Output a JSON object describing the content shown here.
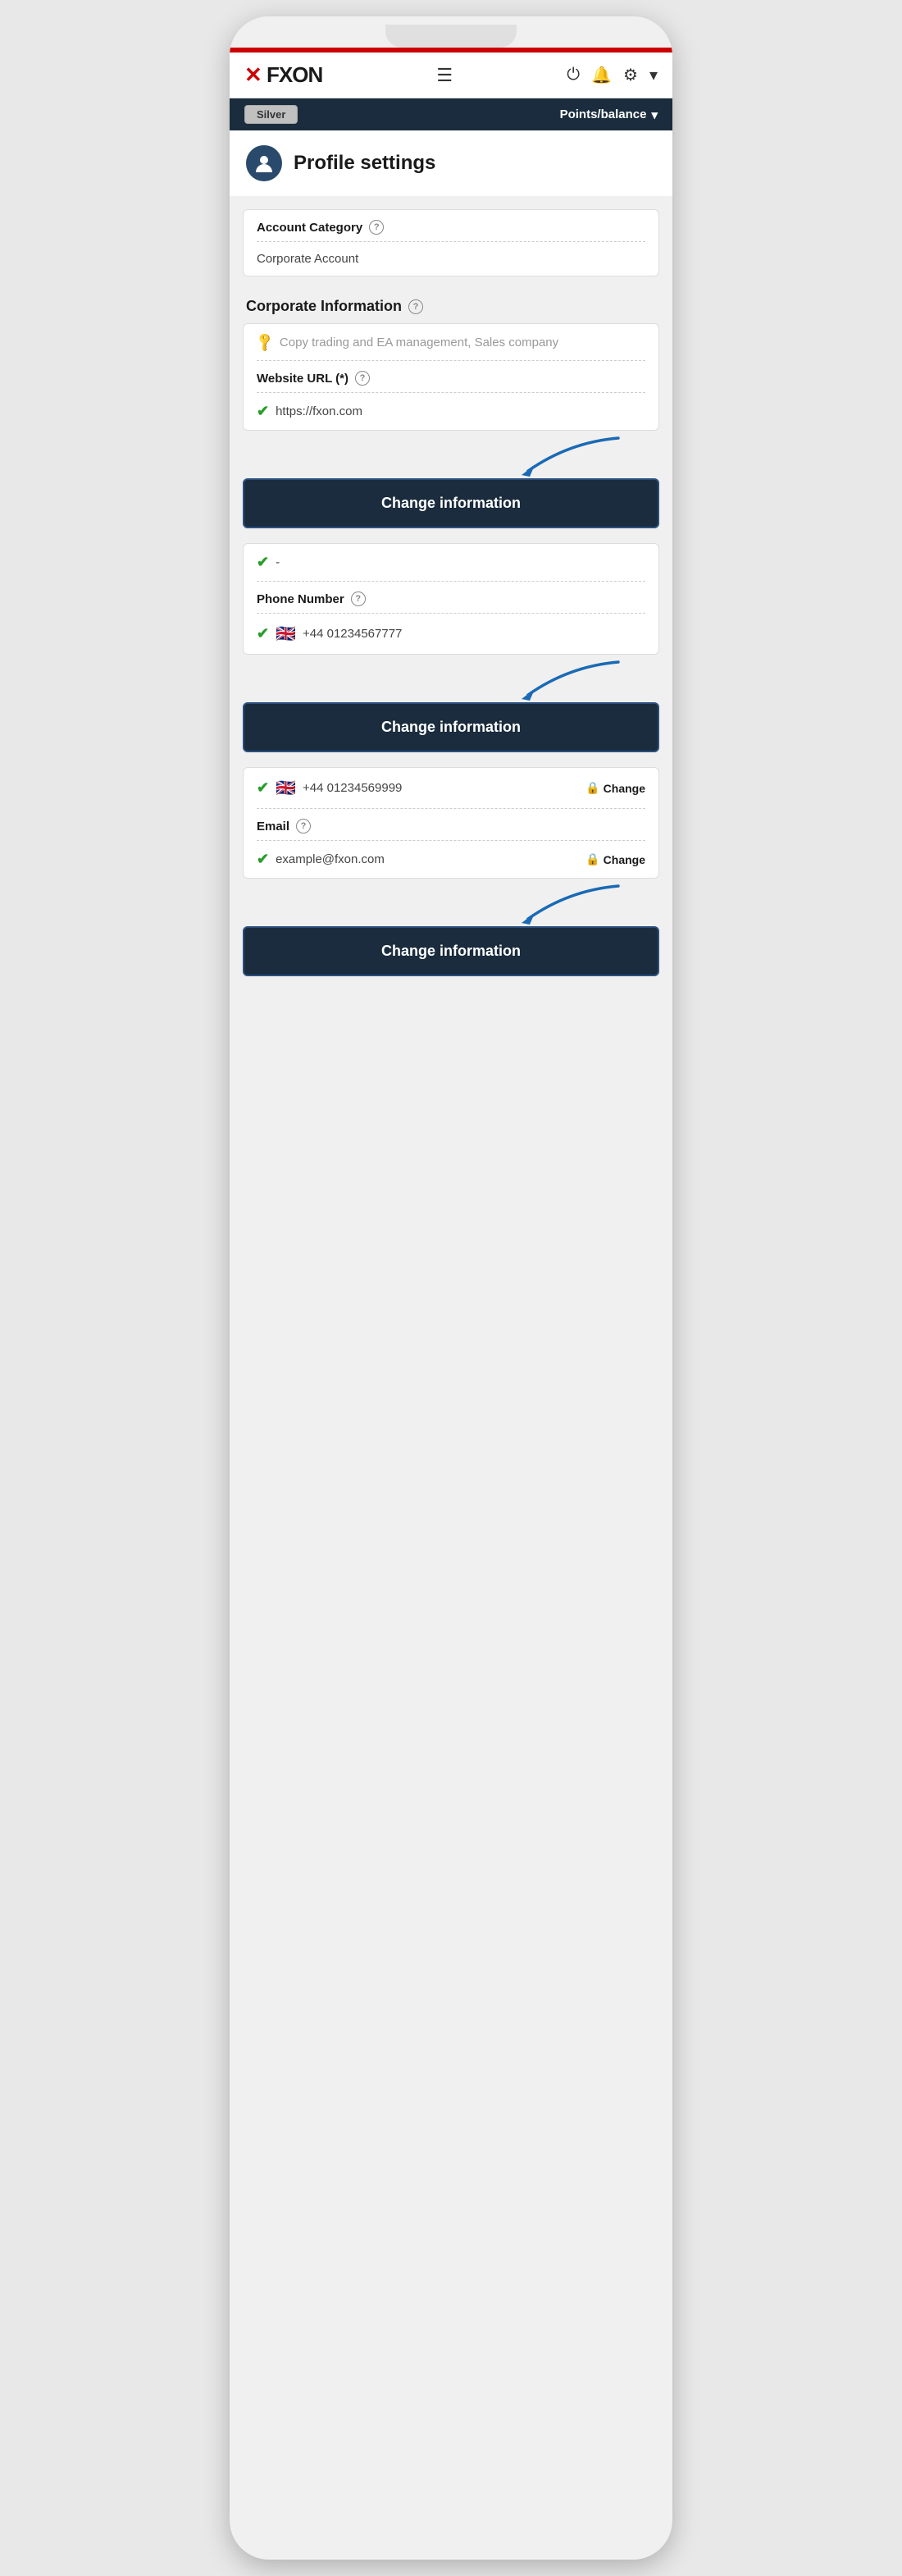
{
  "phone": {
    "top_bar_color": "#cc0000"
  },
  "header": {
    "logo": "FXON",
    "hamburger_label": "☰",
    "icons": {
      "power": "⏻",
      "bell": "🔔",
      "gear": "⚙",
      "chevron": "▾"
    }
  },
  "status_bar": {
    "badge_label": "Silver",
    "points_label": "Points/balance",
    "chevron": "▾"
  },
  "page": {
    "title": "Profile settings"
  },
  "account_category": {
    "label": "Account Category",
    "value": "Corporate Account"
  },
  "corporate_info": {
    "section_label": "Corporate Information",
    "activity_value": "Copy trading and EA management, Sales company",
    "website_label": "Website URL (*)",
    "website_value": "https://fxon.com",
    "check": "✔",
    "change_btn": "Change information"
  },
  "phone_section": {
    "check": "✔",
    "dash_value": "-",
    "phone_label": "Phone Number",
    "phone_flag": "🇬🇧",
    "phone_value": "+44 01234567777",
    "change_btn": "Change information"
  },
  "phone2_section": {
    "check": "✔",
    "phone_flag": "🇬🇧",
    "phone_value": "+44 01234569999",
    "lock": "🔒",
    "change_label": "Change"
  },
  "email_section": {
    "email_label": "Email",
    "check": "✔",
    "email_value": "example@fxon.com",
    "lock": "🔒",
    "change_label": "Change",
    "change_btn": "Change information"
  }
}
